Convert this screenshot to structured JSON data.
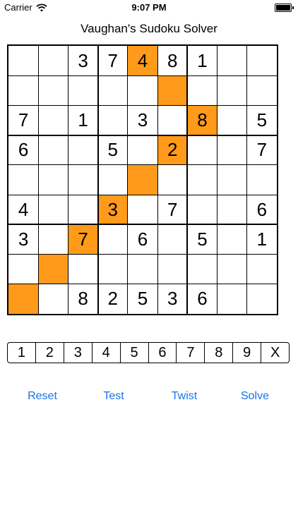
{
  "status_bar": {
    "carrier": "Carrier",
    "time": "9:07 PM",
    "icons": [
      "wifi-icon",
      "battery-icon"
    ]
  },
  "title": "Vaughan's Sudoku Solver",
  "colors": {
    "highlight": "#ff9a1a",
    "action": "#1a73e8"
  },
  "grid": [
    [
      "",
      "",
      "3",
      "7",
      "4",
      "8",
      "1",
      "",
      ""
    ],
    [
      "",
      "",
      "",
      "",
      "",
      "",
      "",
      "",
      ""
    ],
    [
      "7",
      "",
      "1",
      "",
      "3",
      "",
      "8",
      "",
      "5"
    ],
    [
      "6",
      "",
      "",
      "5",
      "",
      "2",
      "",
      "",
      "7"
    ],
    [
      "",
      "",
      "",
      "",
      "",
      "",
      "",
      "",
      ""
    ],
    [
      "4",
      "",
      "",
      "3",
      "",
      "7",
      "",
      "",
      "6"
    ],
    [
      "3",
      "",
      "7",
      "",
      "6",
      "",
      "5",
      "",
      "1"
    ],
    [
      "",
      "",
      "",
      "",
      "",
      "",
      "",
      "",
      ""
    ],
    [
      "",
      "",
      "8",
      "2",
      "5",
      "3",
      "6",
      "",
      ""
    ]
  ],
  "highlighted_cells": [
    [
      0,
      4
    ],
    [
      1,
      5
    ],
    [
      2,
      6
    ],
    [
      3,
      5
    ],
    [
      4,
      4
    ],
    [
      5,
      3
    ],
    [
      6,
      2
    ],
    [
      7,
      1
    ],
    [
      8,
      0
    ]
  ],
  "picker": [
    "1",
    "2",
    "3",
    "4",
    "5",
    "6",
    "7",
    "8",
    "9",
    "X"
  ],
  "actions": [
    "Reset",
    "Test",
    "Twist",
    "Solve"
  ]
}
